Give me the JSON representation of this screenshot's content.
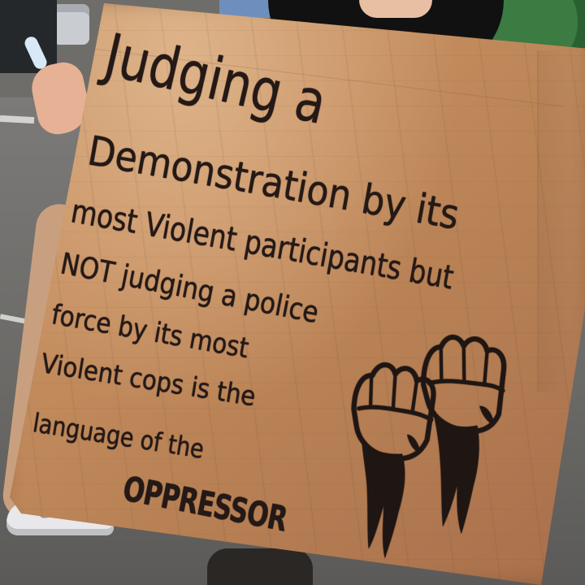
{
  "sign": {
    "lines": [
      "Judging a",
      "Demonstration by its",
      "most Violent participants but",
      "NOT judging a police",
      "force by its most",
      "Violent cops is the",
      "language of the",
      "OPPRESSOR"
    ]
  },
  "colors": {
    "cardboard": "#c48d5e",
    "ink": "#241916",
    "shirt": "#111111",
    "road": "#6f6d69"
  },
  "icons": [
    "raised-fist-icon",
    "raised-fist-icon"
  ]
}
